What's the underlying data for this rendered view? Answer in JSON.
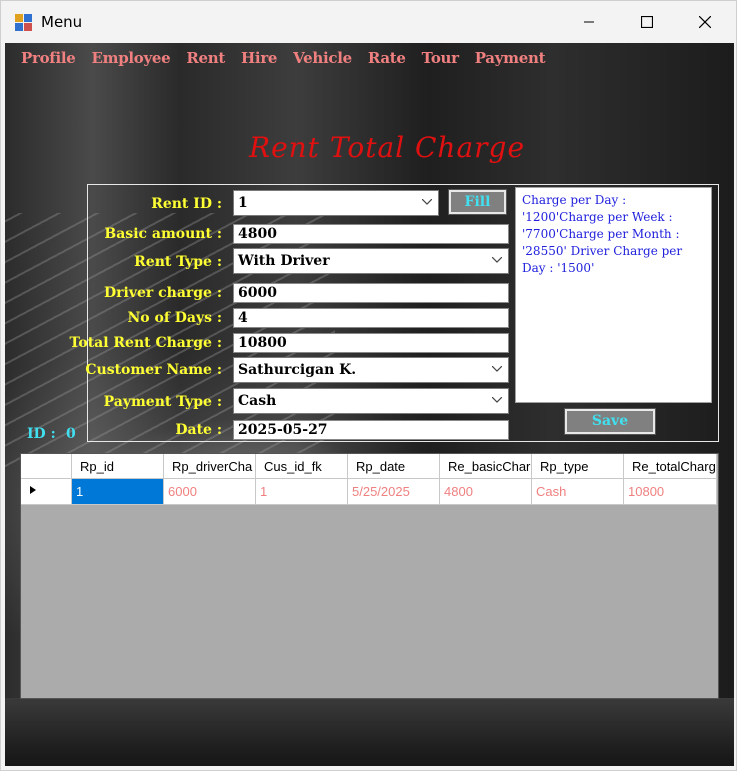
{
  "window": {
    "title": "Menu"
  },
  "menu": [
    "Profile",
    "Employee",
    "Rent",
    "Hire",
    "Vehicle",
    "Rate",
    "Tour",
    "Payment"
  ],
  "form": {
    "title": "Rent Total Charge",
    "rent_id_label": "Rent ID :",
    "rent_id_value": "1",
    "fill_label": "Fill",
    "basic_amount_label": "Basic amount :",
    "basic_amount_value": "4800",
    "rent_type_label": "Rent Type :",
    "rent_type_value": "With Driver",
    "driver_charge_label": "Driver charge :",
    "driver_charge_value": "6000",
    "no_of_days_label": "No of Days :",
    "no_of_days_value": "4",
    "total_rent_label": "Total Rent Charge :",
    "total_rent_value": "10800",
    "customer_name_label": "Customer Name :",
    "customer_name_value": "Sathurcigan K.",
    "payment_type_label": "Payment Type :",
    "payment_type_value": "Cash",
    "date_label": "Date :",
    "date_value": "2025-05-27",
    "info_text": "Charge per Day : '1200'Charge per Week : '7700'Charge per Month : '28550' Driver Charge per Day : '1500'",
    "save_label": "Save",
    "id_label": "ID :",
    "id_value": "0"
  },
  "grid": {
    "columns": [
      "Rp_id",
      "Rp_driverCha",
      "Cus_id_fk",
      "Rp_date",
      "Re_basicChar",
      "Rp_type",
      "Re_totalCharg"
    ],
    "rows": [
      [
        "1",
        "6000",
        "1",
        "5/25/2025",
        "4800",
        "Cash",
        "10800"
      ]
    ]
  },
  "colors": {
    "menu_text": "#f08080",
    "label_text": "#ffff33",
    "title_text": "#e01010",
    "button_text": "#40e0f0",
    "info_text": "#2020dd",
    "selection": "#0078d7"
  }
}
